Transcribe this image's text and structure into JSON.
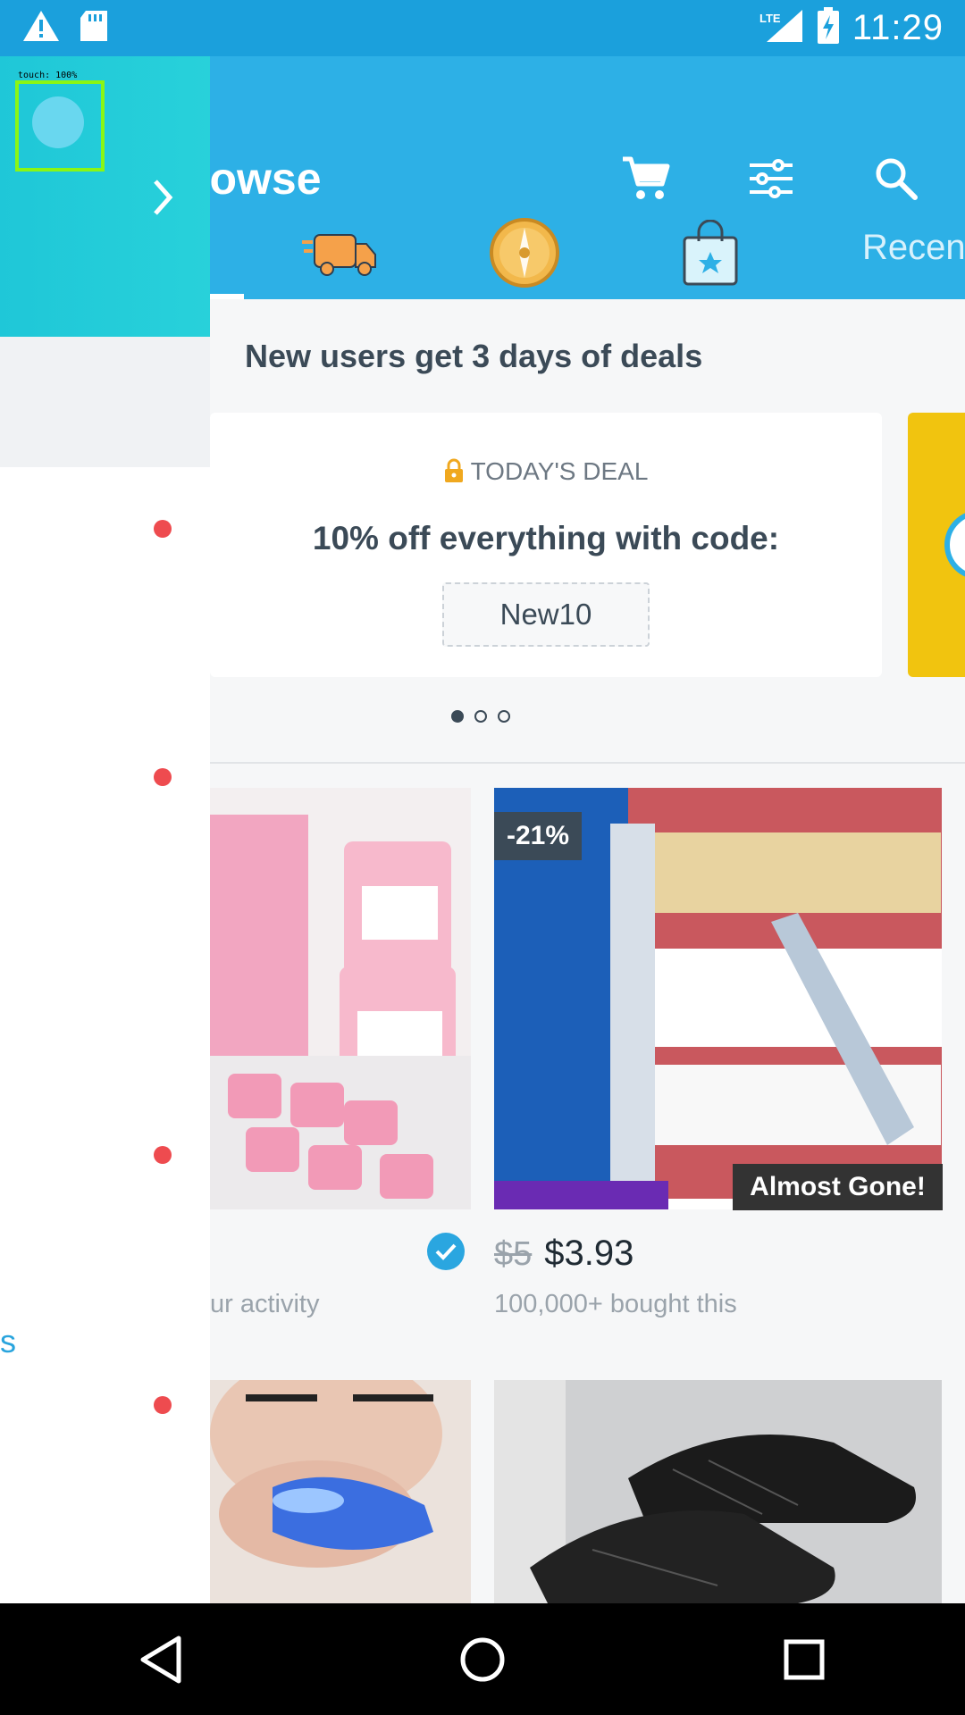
{
  "status": {
    "time": "11:29",
    "network": "LTE"
  },
  "app": {
    "title_partial": "rowse"
  },
  "tabs": {
    "recent_partial": "Recen"
  },
  "deals": {
    "section_title": "New users get 3 days of deals",
    "label": "TODAY'S DEAL",
    "text": "10% off everything with code:",
    "code": "New10"
  },
  "products": [
    {
      "name": "pink-compressed-towels",
      "activity_partial": "ur activity"
    },
    {
      "name": "teeth-whitening-pen",
      "discount_badge": "-21%",
      "stock_badge": "Almost Gone!",
      "old_price": "$5",
      "price": "$3.93",
      "bought": "100,000+ bought this"
    },
    {
      "name": "led-teeth-whitener"
    },
    {
      "name": "black-sneakers"
    }
  ],
  "drawer": {
    "touch_label": "touch: 100%",
    "link_partial": "s"
  },
  "colors": {
    "primary": "#2db0e6",
    "statusbar": "#1ba0dc",
    "drawer_header": "#1fc7d8",
    "notification_dot": "#ee4b4f",
    "text_dark": "#3b4a57"
  }
}
